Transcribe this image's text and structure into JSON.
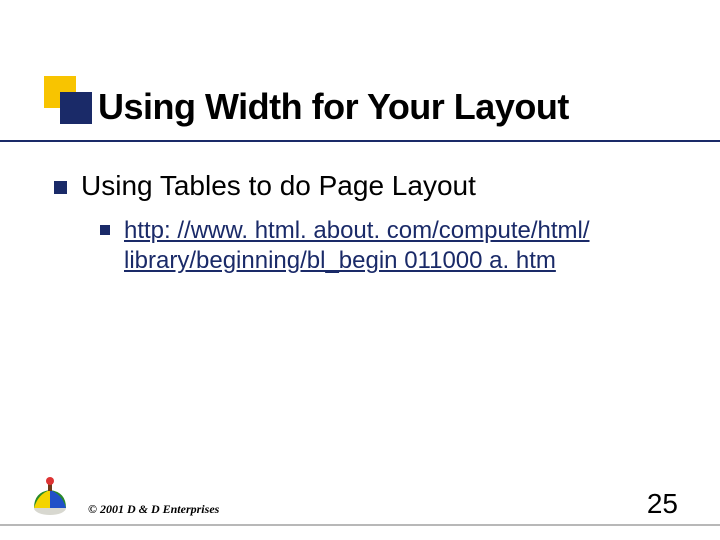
{
  "title": "Using Width for Your Layout",
  "bullet1": "Using Tables to do Page Layout",
  "link_text": "http: //www. html. about. com/compute/html/ library/beginning/bl_begin 011000 a. htm",
  "copyright": "© 2001 D & D Enterprises",
  "page_number": "25"
}
